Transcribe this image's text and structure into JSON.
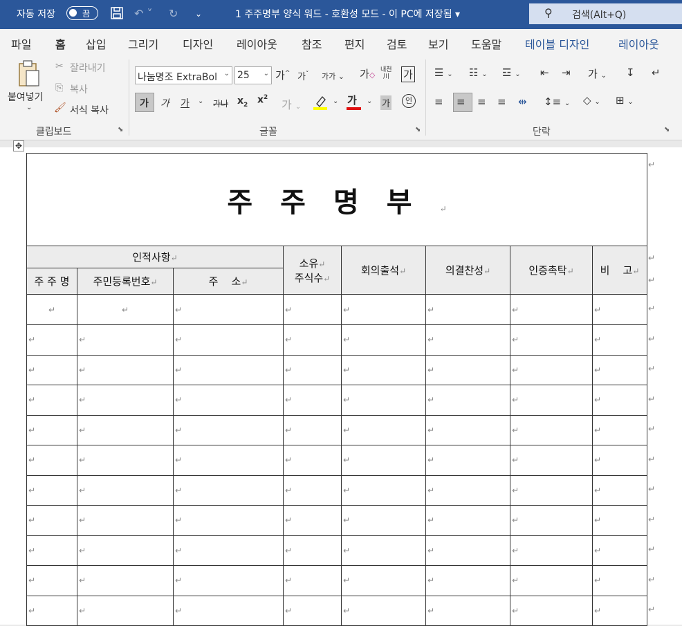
{
  "titlebar": {
    "autosave_label": "자동 저장",
    "toggle_state": "끔",
    "doc_title": "1 주주명부 양식 워드  -  호환성 모드  -  이 PC에 저장됨  ▾",
    "search_label": "검색(Alt+Q)"
  },
  "tabs": [
    "파일",
    "홈",
    "삽입",
    "그리기",
    "디자인",
    "레이아웃",
    "참조",
    "편지",
    "검토",
    "보기",
    "도움말",
    "테이블 디자인",
    "레이아웃"
  ],
  "active_tab": "홈",
  "ribbon": {
    "clipboard": {
      "paste": "붙여넣기",
      "cut": "잘라내기",
      "copy": "복사",
      "format_painter": "서식 복사",
      "group_label": "클립보드"
    },
    "font": {
      "font_name": "나눔명조 ExtraBol",
      "font_size": "25",
      "group_label": "글꼴"
    },
    "paragraph": {
      "group_label": "단락"
    }
  },
  "document": {
    "title": "주주명부",
    "headers": {
      "personal": "인적사항",
      "name": "주 주 명",
      "id_number": "주민등록번호",
      "address": "주    소",
      "shares_line1": "소유",
      "shares_line2": "주식수",
      "attendance": "회의출석",
      "vote": "의결찬성",
      "certification": "인증촉탁",
      "remarks": "비    고"
    },
    "pilcrow": "↵",
    "empty_rows": 11
  }
}
